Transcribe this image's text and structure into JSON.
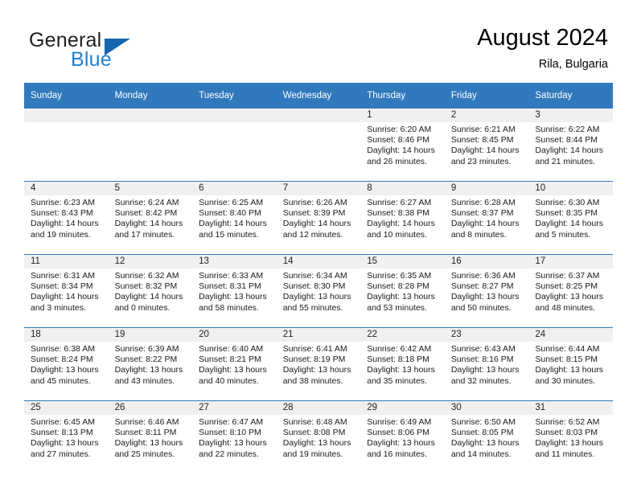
{
  "brand": {
    "word_one": "General",
    "word_two": "Blue",
    "triangle_color": "#1565b0",
    "blue_color": "#1f7fd0"
  },
  "header": {
    "title": "August 2024",
    "subtitle": "Rila, Bulgaria",
    "accent_color": "#3179bd",
    "daynum_band_color": "#f0f0f0"
  },
  "labels": {
    "sunrise_prefix": "Sunrise:",
    "sunset_prefix": "Sunset:",
    "daylight_prefix": "Daylight:"
  },
  "weekdays": [
    "Sunday",
    "Monday",
    "Tuesday",
    "Wednesday",
    "Thursday",
    "Friday",
    "Saturday"
  ],
  "weeks": [
    [
      {
        "day": "",
        "sunrise": "",
        "sunset": "",
        "daylight_line1": "",
        "daylight_line2": ""
      },
      {
        "day": "",
        "sunrise": "",
        "sunset": "",
        "daylight_line1": "",
        "daylight_line2": ""
      },
      {
        "day": "",
        "sunrise": "",
        "sunset": "",
        "daylight_line1": "",
        "daylight_line2": ""
      },
      {
        "day": "",
        "sunrise": "",
        "sunset": "",
        "daylight_line1": "",
        "daylight_line2": ""
      },
      {
        "day": "1",
        "sunrise": "Sunrise: 6:20 AM",
        "sunset": "Sunset: 8:46 PM",
        "daylight_line1": "Daylight: 14 hours",
        "daylight_line2": "and 26 minutes."
      },
      {
        "day": "2",
        "sunrise": "Sunrise: 6:21 AM",
        "sunset": "Sunset: 8:45 PM",
        "daylight_line1": "Daylight: 14 hours",
        "daylight_line2": "and 23 minutes."
      },
      {
        "day": "3",
        "sunrise": "Sunrise: 6:22 AM",
        "sunset": "Sunset: 8:44 PM",
        "daylight_line1": "Daylight: 14 hours",
        "daylight_line2": "and 21 minutes."
      }
    ],
    [
      {
        "day": "4",
        "sunrise": "Sunrise: 6:23 AM",
        "sunset": "Sunset: 8:43 PM",
        "daylight_line1": "Daylight: 14 hours",
        "daylight_line2": "and 19 minutes."
      },
      {
        "day": "5",
        "sunrise": "Sunrise: 6:24 AM",
        "sunset": "Sunset: 8:42 PM",
        "daylight_line1": "Daylight: 14 hours",
        "daylight_line2": "and 17 minutes."
      },
      {
        "day": "6",
        "sunrise": "Sunrise: 6:25 AM",
        "sunset": "Sunset: 8:40 PM",
        "daylight_line1": "Daylight: 14 hours",
        "daylight_line2": "and 15 minutes."
      },
      {
        "day": "7",
        "sunrise": "Sunrise: 6:26 AM",
        "sunset": "Sunset: 8:39 PM",
        "daylight_line1": "Daylight: 14 hours",
        "daylight_line2": "and 12 minutes."
      },
      {
        "day": "8",
        "sunrise": "Sunrise: 6:27 AM",
        "sunset": "Sunset: 8:38 PM",
        "daylight_line1": "Daylight: 14 hours",
        "daylight_line2": "and 10 minutes."
      },
      {
        "day": "9",
        "sunrise": "Sunrise: 6:28 AM",
        "sunset": "Sunset: 8:37 PM",
        "daylight_line1": "Daylight: 14 hours",
        "daylight_line2": "and 8 minutes."
      },
      {
        "day": "10",
        "sunrise": "Sunrise: 6:30 AM",
        "sunset": "Sunset: 8:35 PM",
        "daylight_line1": "Daylight: 14 hours",
        "daylight_line2": "and 5 minutes."
      }
    ],
    [
      {
        "day": "11",
        "sunrise": "Sunrise: 6:31 AM",
        "sunset": "Sunset: 8:34 PM",
        "daylight_line1": "Daylight: 14 hours",
        "daylight_line2": "and 3 minutes."
      },
      {
        "day": "12",
        "sunrise": "Sunrise: 6:32 AM",
        "sunset": "Sunset: 8:32 PM",
        "daylight_line1": "Daylight: 14 hours",
        "daylight_line2": "and 0 minutes."
      },
      {
        "day": "13",
        "sunrise": "Sunrise: 6:33 AM",
        "sunset": "Sunset: 8:31 PM",
        "daylight_line1": "Daylight: 13 hours",
        "daylight_line2": "and 58 minutes."
      },
      {
        "day": "14",
        "sunrise": "Sunrise: 6:34 AM",
        "sunset": "Sunset: 8:30 PM",
        "daylight_line1": "Daylight: 13 hours",
        "daylight_line2": "and 55 minutes."
      },
      {
        "day": "15",
        "sunrise": "Sunrise: 6:35 AM",
        "sunset": "Sunset: 8:28 PM",
        "daylight_line1": "Daylight: 13 hours",
        "daylight_line2": "and 53 minutes."
      },
      {
        "day": "16",
        "sunrise": "Sunrise: 6:36 AM",
        "sunset": "Sunset: 8:27 PM",
        "daylight_line1": "Daylight: 13 hours",
        "daylight_line2": "and 50 minutes."
      },
      {
        "day": "17",
        "sunrise": "Sunrise: 6:37 AM",
        "sunset": "Sunset: 8:25 PM",
        "daylight_line1": "Daylight: 13 hours",
        "daylight_line2": "and 48 minutes."
      }
    ],
    [
      {
        "day": "18",
        "sunrise": "Sunrise: 6:38 AM",
        "sunset": "Sunset: 8:24 PM",
        "daylight_line1": "Daylight: 13 hours",
        "daylight_line2": "and 45 minutes."
      },
      {
        "day": "19",
        "sunrise": "Sunrise: 6:39 AM",
        "sunset": "Sunset: 8:22 PM",
        "daylight_line1": "Daylight: 13 hours",
        "daylight_line2": "and 43 minutes."
      },
      {
        "day": "20",
        "sunrise": "Sunrise: 6:40 AM",
        "sunset": "Sunset: 8:21 PM",
        "daylight_line1": "Daylight: 13 hours",
        "daylight_line2": "and 40 minutes."
      },
      {
        "day": "21",
        "sunrise": "Sunrise: 6:41 AM",
        "sunset": "Sunset: 8:19 PM",
        "daylight_line1": "Daylight: 13 hours",
        "daylight_line2": "and 38 minutes."
      },
      {
        "day": "22",
        "sunrise": "Sunrise: 6:42 AM",
        "sunset": "Sunset: 8:18 PM",
        "daylight_line1": "Daylight: 13 hours",
        "daylight_line2": "and 35 minutes."
      },
      {
        "day": "23",
        "sunrise": "Sunrise: 6:43 AM",
        "sunset": "Sunset: 8:16 PM",
        "daylight_line1": "Daylight: 13 hours",
        "daylight_line2": "and 32 minutes."
      },
      {
        "day": "24",
        "sunrise": "Sunrise: 6:44 AM",
        "sunset": "Sunset: 8:15 PM",
        "daylight_line1": "Daylight: 13 hours",
        "daylight_line2": "and 30 minutes."
      }
    ],
    [
      {
        "day": "25",
        "sunrise": "Sunrise: 6:45 AM",
        "sunset": "Sunset: 8:13 PM",
        "daylight_line1": "Daylight: 13 hours",
        "daylight_line2": "and 27 minutes."
      },
      {
        "day": "26",
        "sunrise": "Sunrise: 6:46 AM",
        "sunset": "Sunset: 8:11 PM",
        "daylight_line1": "Daylight: 13 hours",
        "daylight_line2": "and 25 minutes."
      },
      {
        "day": "27",
        "sunrise": "Sunrise: 6:47 AM",
        "sunset": "Sunset: 8:10 PM",
        "daylight_line1": "Daylight: 13 hours",
        "daylight_line2": "and 22 minutes."
      },
      {
        "day": "28",
        "sunrise": "Sunrise: 6:48 AM",
        "sunset": "Sunset: 8:08 PM",
        "daylight_line1": "Daylight: 13 hours",
        "daylight_line2": "and 19 minutes."
      },
      {
        "day": "29",
        "sunrise": "Sunrise: 6:49 AM",
        "sunset": "Sunset: 8:06 PM",
        "daylight_line1": "Daylight: 13 hours",
        "daylight_line2": "and 16 minutes."
      },
      {
        "day": "30",
        "sunrise": "Sunrise: 6:50 AM",
        "sunset": "Sunset: 8:05 PM",
        "daylight_line1": "Daylight: 13 hours",
        "daylight_line2": "and 14 minutes."
      },
      {
        "day": "31",
        "sunrise": "Sunrise: 6:52 AM",
        "sunset": "Sunset: 8:03 PM",
        "daylight_line1": "Daylight: 13 hours",
        "daylight_line2": "and 11 minutes."
      }
    ]
  ]
}
